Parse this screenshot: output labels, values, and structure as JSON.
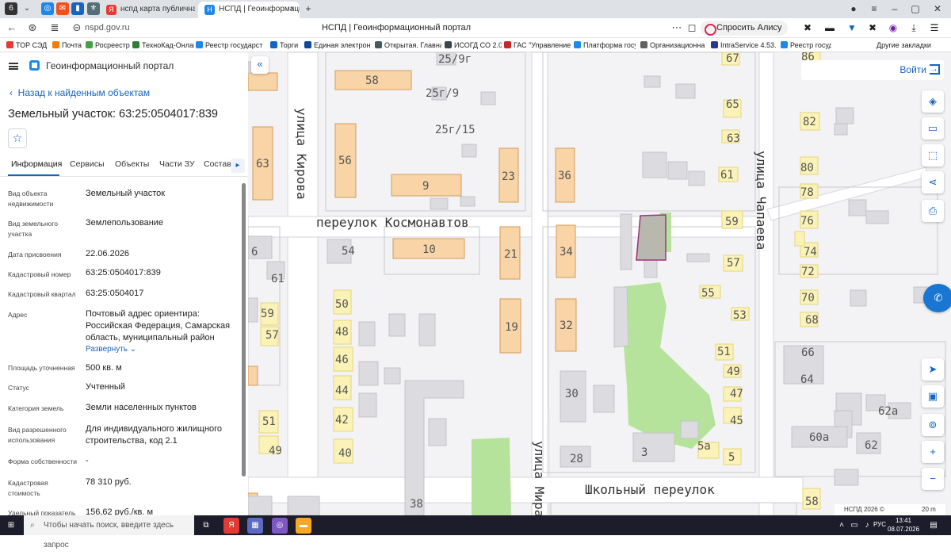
{
  "browser": {
    "tabs": [
      {
        "label": "нспд карта публичная ка",
        "icon": "yandex-icon",
        "color": "#e53935"
      },
      {
        "label": "НСПД | Геоинформаци",
        "icon": "nspd-icon",
        "color": "#1e88e5"
      }
    ],
    "url": "nspd.gov.ru",
    "page_title": "НСПД | Геоинформационный портал",
    "alice_label": "Спросить Алису AI",
    "bookmarks": [
      "ТОР СЭД",
      "Почта",
      "Росреестр",
      "ТехноКад-Онлайн",
      "Реестр государст",
      "Торги",
      "Единая электрон",
      "Открытая. Главна",
      "ИСОГД СО 2.0",
      "ГАС \"Управление",
      "Платформа госуд",
      "Организационна",
      "IntraService 4.53.1",
      "Реестр госуда"
    ],
    "other_bookmarks": "Другие закладки"
  },
  "sidebar": {
    "brand": "Геоинформационный портал",
    "back_label": "Назад к найденным объектам",
    "object_title": "Земельный участок: 63:25:0504017:839",
    "tabs": [
      "Информация",
      "Сервисы",
      "Объекты",
      "Части ЗУ",
      "Состав"
    ],
    "fields": [
      {
        "label": "Вид объекта недвижимости",
        "value": "Земельный участок"
      },
      {
        "label": "Вид земельного участка",
        "value": "Землепользование"
      },
      {
        "label": "Дата присвоения",
        "value": "22.06.2026"
      },
      {
        "label": "Кадастровый номер",
        "value": "63:25:0504017:839"
      },
      {
        "label": "Кадастровый квартал",
        "value": "63:25:0504017"
      },
      {
        "label": "Адрес",
        "value": "Почтовый адрес ориентира: Российская Федерация, Самарская область, муниципальный район"
      },
      {
        "label": "Площадь уточненная",
        "value": "500 кв. м"
      },
      {
        "label": "Статус",
        "value": "Учтенный"
      },
      {
        "label": "Категория земель",
        "value": "Земли населенных пунктов"
      },
      {
        "label": "Вид разрешенного использования",
        "value": "Для индивидуального жилищного строительства, код 2.1"
      },
      {
        "label": "Форма собственности",
        "value": "-"
      },
      {
        "label": "Кадастровая стоимость",
        "value": "78 310 руб."
      },
      {
        "label": "Удельный показатель",
        "value": "156,62 руб./кв. м"
      }
    ],
    "expand_label": "Развернуть"
  },
  "map": {
    "login_label": "Войти",
    "streets": [
      "улица Кирова",
      "переулок Космонавтов",
      "улица Чапаева",
      "улица Мира",
      "Школьный переулок"
    ],
    "house_numbers": [
      "25/9г",
      "58",
      "25г/9",
      "25г/15",
      "67",
      "86",
      "65",
      "82",
      "63",
      "56",
      "9",
      "23",
      "36",
      "61",
      "80",
      "78",
      "63",
      "54",
      "10",
      "21",
      "34",
      "59",
      "76",
      "57",
      "74",
      "6",
      "61",
      "72",
      "55",
      "70",
      "50",
      "53",
      "68",
      "59",
      "57",
      "48",
      "19",
      "32",
      "66",
      "46",
      "51",
      "49",
      "64",
      "44",
      "30",
      "47",
      "62а",
      "42",
      "45",
      "51",
      "49",
      "40",
      "3",
      "5а",
      "60а",
      "62",
      "28",
      "5",
      "38",
      "58"
    ],
    "scale_attribution": "НСПД 2026 ©",
    "scale_label": "20 m"
  },
  "taskbar": {
    "search_placeholder": "Чтобы начать поиск, введите здесь запрос",
    "lang": "РУС",
    "time": "13:41",
    "date": "08.07.2026"
  }
}
